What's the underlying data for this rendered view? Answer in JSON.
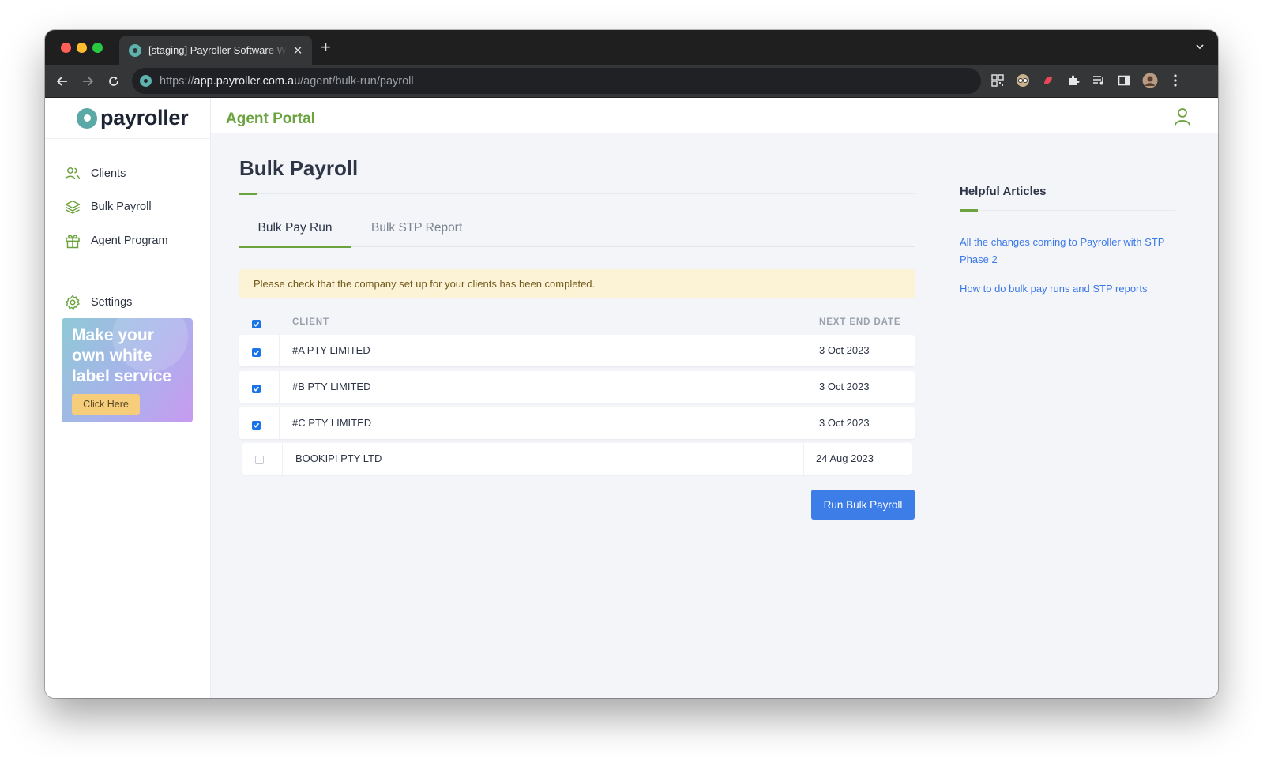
{
  "browser": {
    "tab_title": "[staging] Payroller Software Web App",
    "url_scheme": "https://",
    "url_host": "app.payroller.com.au",
    "url_path": "/agent/bulk-run/payroll"
  },
  "sidebar": {
    "logo": "payroller",
    "items": [
      {
        "label": "Clients",
        "icon": "users-icon"
      },
      {
        "label": "Bulk Payroll",
        "icon": "layers-icon"
      },
      {
        "label": "Agent Program",
        "icon": "gift-icon"
      },
      {
        "label": "Settings",
        "icon": "gear-icon"
      }
    ],
    "promo": {
      "text": "Make your own white label service",
      "button": "Click Here"
    }
  },
  "header": {
    "portal_title": "Agent Portal"
  },
  "main": {
    "title": "Bulk Payroll",
    "tabs": [
      {
        "label": "Bulk Pay Run",
        "active": true
      },
      {
        "label": "Bulk STP Report",
        "active": false
      }
    ],
    "alert": "Please check that the company set up for your clients has been completed.",
    "table": {
      "columns": [
        "CLIENT",
        "NEXT END DATE"
      ],
      "select_all": true,
      "rows": [
        {
          "client": "#A PTY LIMITED",
          "date": "3 Oct 2023",
          "checked": true
        },
        {
          "client": "#B PTY LIMITED",
          "date": "3 Oct 2023",
          "checked": true
        },
        {
          "client": "#C PTY LIMITED",
          "date": "3 Oct 2023",
          "checked": true
        },
        {
          "client": "BOOKIPI PTY LTD",
          "date": "24 Aug 2023",
          "checked": false
        }
      ]
    },
    "run_button": "Run Bulk Payroll"
  },
  "help": {
    "title": "Helpful Articles",
    "links": [
      "All the changes coming to Payroller with STP Phase 2",
      "How to do bulk pay runs and STP reports"
    ]
  },
  "colors": {
    "brand_green": "#6ba33f",
    "primary_blue": "#3d7de8",
    "link_blue": "#3b78e7",
    "alert_bg": "#fcf2d6"
  }
}
